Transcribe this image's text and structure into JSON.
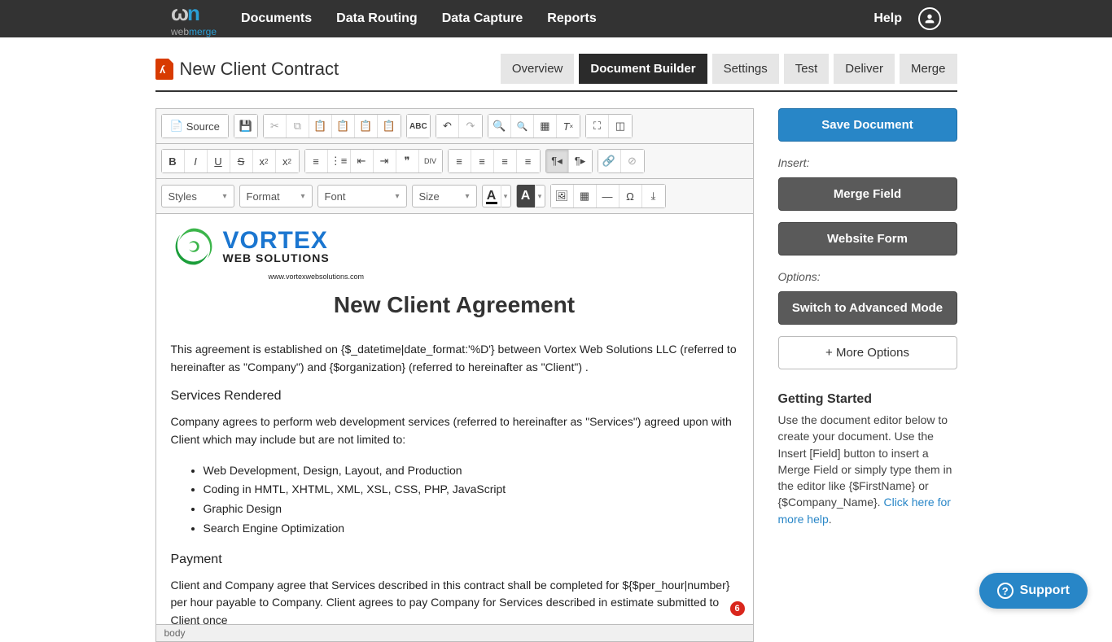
{
  "topnav": {
    "items": [
      "Documents",
      "Data Routing",
      "Data Capture",
      "Reports"
    ],
    "help": "Help"
  },
  "brand": {
    "name1": "web",
    "name2": "merge"
  },
  "page": {
    "title": "New Client Contract"
  },
  "tabs": [
    "Overview",
    "Document Builder",
    "Settings",
    "Test",
    "Deliver",
    "Merge"
  ],
  "active_tab": "Document Builder",
  "toolbar": {
    "source": "Source",
    "selects": {
      "styles": "Styles",
      "format": "Format",
      "font": "Font",
      "size": "Size"
    }
  },
  "doc": {
    "logo_name": "VORTEX",
    "logo_sub": "WEB SOLUTIONS",
    "logo_url": "www.vortexwebsolutions.com",
    "title": "New Client Agreement",
    "intro": "This agreement is established on {$_datetime|date_format:'%D'} between Vortex Web Solutions LLC (referred to hereinafter as \"Company\") and {$organization} (referred to hereinafter as \"Client\") .",
    "services_h": "Services Rendered",
    "services_p": "Company agrees to perform web development services (referred to hereinafter as \"Services\") agreed upon with Client which may include but are not limited to:",
    "services_list": [
      "Web Development, Design, Layout, and Production",
      "Coding in HMTL, XHTML, XML, XSL, CSS, PHP, JavaScript",
      "Graphic Design",
      "Search Engine Optimization"
    ],
    "payment_h": "Payment",
    "payment_p": "Client and Company agree that Services described in this contract shall be completed for ${$per_hour|number} per hour payable to Company. Client agrees to pay Company for Services described in estimate submitted to Client once"
  },
  "path_bar": "body",
  "badge": "6",
  "side": {
    "save": "Save Document",
    "insert_label": "Insert:",
    "merge_field": "Merge Field",
    "website_form": "Website Form",
    "options_label": "Options:",
    "advanced": "Switch to Advanced Mode",
    "more": "+ More Options",
    "gs_title": "Getting Started",
    "gs_text": "Use the document editor below to create your document. Use the Insert [Field] button to insert a Merge Field or simply type them in the editor like {$FirstName} or {$Company_Name}. ",
    "gs_link": "Click here for more help"
  },
  "support": "Support"
}
